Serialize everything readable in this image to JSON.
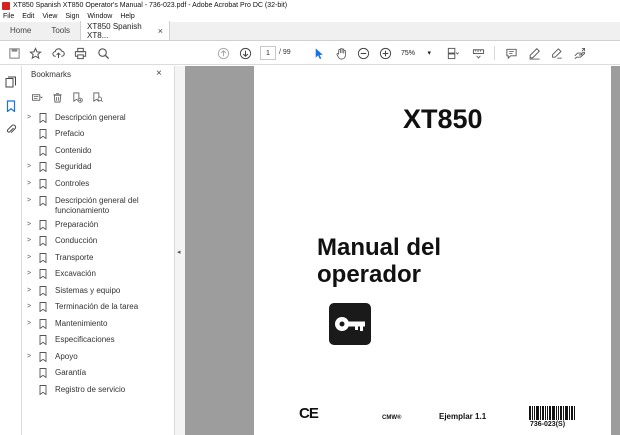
{
  "window": {
    "title": "XT850 Spanish XT850 Operator's Manual - 736-023.pdf - Adobe Acrobat Pro DC (32-bit)"
  },
  "menu": [
    "File",
    "Edit",
    "View",
    "Sign",
    "Window",
    "Help"
  ],
  "tabs": {
    "home": "Home",
    "tools": "Tools",
    "document": "XT850 Spanish XT8...",
    "close": "×"
  },
  "toolbar": {
    "page_current": "1",
    "page_total": "/ 99",
    "zoom": "75%",
    "zoom_caret": "▾"
  },
  "panel": {
    "title": "Bookmarks",
    "close": "×"
  },
  "bookmarks": [
    {
      "label": "Descripción general",
      "expandable": true
    },
    {
      "label": "Prefacio",
      "expandable": false
    },
    {
      "label": "Contenido",
      "expandable": false
    },
    {
      "label": "Seguridad",
      "expandable": true
    },
    {
      "label": "Controles",
      "expandable": true
    },
    {
      "label": "Descripción general del funcionamiento",
      "expandable": true
    },
    {
      "label": "Preparación",
      "expandable": true
    },
    {
      "label": "Conducción",
      "expandable": true
    },
    {
      "label": "Transporte",
      "expandable": true
    },
    {
      "label": "Excavación",
      "expandable": true
    },
    {
      "label": "Sistemas y equipo",
      "expandable": true
    },
    {
      "label": "Terminación de la tarea",
      "expandable": true
    },
    {
      "label": "Mantenimiento",
      "expandable": true
    },
    {
      "label": "Especificaciones",
      "expandable": false
    },
    {
      "label": "Apoyo",
      "expandable": true
    },
    {
      "label": "Garantía",
      "expandable": false
    },
    {
      "label": "Registro de servicio",
      "expandable": false
    }
  ],
  "document": {
    "model": "XT850",
    "title_line1": "Manual del",
    "title_line2": "operador",
    "ce": "CE",
    "cmw": "CMW®",
    "ejemplar": "Ejemplar 1.1",
    "code": "736-023(S)"
  },
  "colors": {
    "viewer_background": "#9d9d9d",
    "acrobat_red": "#d7231f",
    "active_tool": "#1473e6"
  }
}
